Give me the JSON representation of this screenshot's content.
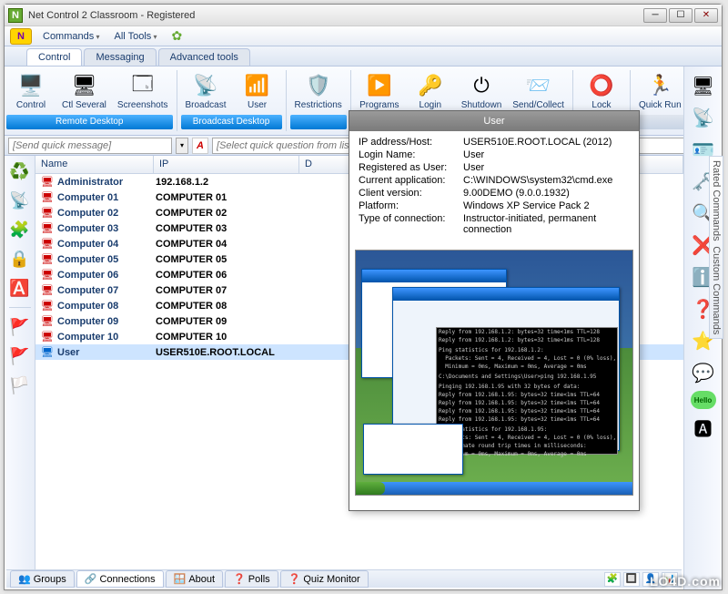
{
  "window": {
    "title": "Net Control 2 Classroom - Registered"
  },
  "menubar": {
    "commands": "Commands",
    "alltools": "All Tools"
  },
  "tabs": {
    "control": "Control",
    "messaging": "Messaging",
    "advanced": "Advanced tools"
  },
  "ribbon": {
    "groups": [
      {
        "label": "Remote Desktop",
        "active": true,
        "items": [
          {
            "label": "Control",
            "icon": "🖥️"
          },
          {
            "label": "Ctl Several",
            "icon": "🖥"
          },
          {
            "label": "Screenshots",
            "icon": "🗔"
          }
        ]
      },
      {
        "label": "Broadcast Desktop",
        "active": true,
        "items": [
          {
            "label": "Broadcast",
            "icon": "📡"
          },
          {
            "label": "User",
            "icon": "📶"
          }
        ]
      },
      {
        "label": "",
        "active": true,
        "items": [
          {
            "label": "Restrictions",
            "icon": "🛡️"
          }
        ]
      },
      {
        "label": "",
        "active": false,
        "items": [
          {
            "label": "Programs",
            "icon": "▶️"
          },
          {
            "label": "Login",
            "icon": "🔑"
          },
          {
            "label": "Shutdown",
            "icon": "⏻"
          },
          {
            "label": "Send/Collect",
            "icon": "📨"
          }
        ]
      },
      {
        "label": "",
        "active": false,
        "items": [
          {
            "label": "Lock",
            "icon": "⭕"
          }
        ]
      },
      {
        "label": "",
        "active": false,
        "items": [
          {
            "label": "Quick Run",
            "icon": "🏃"
          }
        ]
      }
    ]
  },
  "quickbar": {
    "msg_placeholder": "[Send quick message]",
    "question_placeholder": "[Select quick question from list]"
  },
  "list": {
    "headers": {
      "name": "Name",
      "ip": "IP",
      "desc": "D"
    },
    "rows": [
      {
        "name": "Administrator",
        "ip": "192.168.1.2",
        "icon": "🖥",
        "color": "#c00"
      },
      {
        "name": "Computer 01",
        "ip": "COMPUTER 01",
        "icon": "🖥",
        "color": "#c00"
      },
      {
        "name": "Computer 02",
        "ip": "COMPUTER 02",
        "icon": "🖥",
        "color": "#c00"
      },
      {
        "name": "Computer 03",
        "ip": "COMPUTER 03",
        "icon": "🖥",
        "color": "#c00"
      },
      {
        "name": "Computer 04",
        "ip": "COMPUTER 04",
        "icon": "🖥",
        "color": "#c00"
      },
      {
        "name": "Computer 05",
        "ip": "COMPUTER 05",
        "icon": "🖥",
        "color": "#c00"
      },
      {
        "name": "Computer 06",
        "ip": "COMPUTER 06",
        "icon": "🖥",
        "color": "#c00"
      },
      {
        "name": "Computer 07",
        "ip": "COMPUTER 07",
        "icon": "🖥",
        "color": "#c00"
      },
      {
        "name": "Computer 08",
        "ip": "COMPUTER 08",
        "icon": "🖥",
        "color": "#c00"
      },
      {
        "name": "Computer 09",
        "ip": "COMPUTER 09",
        "icon": "🖥",
        "color": "#c00"
      },
      {
        "name": "Computer 10",
        "ip": "COMPUTER 10",
        "icon": "🖥",
        "color": "#c00"
      },
      {
        "name": "User",
        "ip": "USER510E.ROOT.LOCAL",
        "icon": "🖥",
        "color": "#06c",
        "selected": true
      }
    ]
  },
  "leftbar_icons": [
    "♻️",
    "📡",
    "🧩",
    "🔒",
    "🅰️",
    "",
    "🚩",
    "🚩",
    "🏳️"
  ],
  "rightbar_icons": [
    "🖥",
    "📡",
    "🪪",
    "🗝️",
    "🔍",
    "❌",
    "ℹ️",
    "❓",
    "⭐",
    "💬",
    "Hello",
    "🅰"
  ],
  "rightbar_labels": {
    "rated": "Rated Commands",
    "custom": "Custom Commands"
  },
  "popup": {
    "title": "User",
    "rows": [
      {
        "label": "IP address/Host:",
        "value": "USER510E.ROOT.LOCAL (2012)"
      },
      {
        "label": "Login Name:",
        "value": "User"
      },
      {
        "label": "Registered as User:",
        "value": "User"
      },
      {
        "label": "Current application:",
        "value": "C:\\WINDOWS\\system32\\cmd.exe"
      },
      {
        "label": "Client version:",
        "value": "9.00DEMO (9.0.0.1932)"
      },
      {
        "label": "Platform:",
        "value": "Windows XP Service Pack 2"
      },
      {
        "label": "Type of connection:",
        "value": "Instructor-initiated, permanent connection"
      }
    ],
    "cmd_lines": [
      "Reply from 192.168.1.2: bytes=32 time<1ms TTL=128",
      "Reply from 192.168.1.2: bytes=32 time<1ms TTL=128",
      "",
      "Ping statistics for 192.168.1.2:",
      "  Packets: Sent = 4, Received = 4, Lost = 0 (0% loss),",
      "  Minimum = 0ms, Maximum = 0ms, Average = 0ms",
      "",
      "C:\\Documents and Settings\\User>ping 192.168.1.95",
      "",
      "Pinging 192.168.1.95 with 32 bytes of data:",
      "Reply from 192.168.1.95: bytes=32 time<1ms TTL=64",
      "Reply from 192.168.1.95: bytes=32 time<1ms TTL=64",
      "Reply from 192.168.1.95: bytes=32 time<1ms TTL=64",
      "Reply from 192.168.1.95: bytes=32 time<1ms TTL=64",
      "",
      "Ping statistics for 192.168.1.95:",
      "  Packets: Sent = 4, Received = 4, Lost = 0 (0% loss),",
      "Approximate round trip times in milliseconds:",
      "  Minimum = 0ms, Maximum = 0ms, Average = 0ms"
    ]
  },
  "status_tabs": [
    {
      "label": "Groups",
      "icon": "👥"
    },
    {
      "label": "Connections",
      "icon": "🔗",
      "active": true
    },
    {
      "label": "About",
      "icon": "🪟"
    },
    {
      "label": "Polls",
      "icon": "❓"
    },
    {
      "label": "Quiz Monitor",
      "icon": "❓"
    }
  ],
  "watermark": "LO4D.com"
}
